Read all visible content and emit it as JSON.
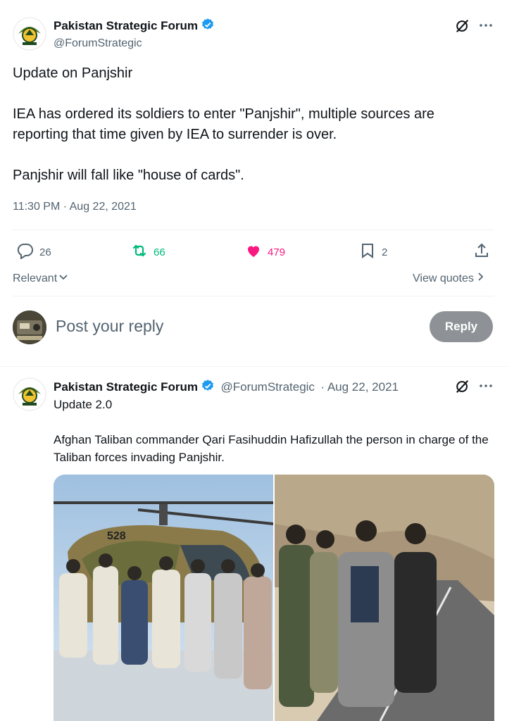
{
  "main_tweet": {
    "author_name": "Pakistan Strategic Forum",
    "author_handle": "@ForumStrategic",
    "text": "Update on Panjshir\n\nIEA has ordered its soldiers to enter \"Panjshir\", multiple sources are reporting that time given by IEA to surrender is over.\n\nPanjshir will fall like \"house of cards\".",
    "timestamp": "11:30 PM · Aug 22, 2021",
    "replies": "26",
    "retweets": "66",
    "likes": "479",
    "bookmarks": "2"
  },
  "sort": {
    "label": "Relevant",
    "view_quotes": "View quotes"
  },
  "composer": {
    "placeholder": "Post your reply",
    "reply_label": "Reply"
  },
  "reply_tweet": {
    "author_name": "Pakistan Strategic Forum",
    "author_handle": "@ForumStrategic",
    "date": "· Aug 22, 2021",
    "title": "Update 2.0",
    "text": "Afghan Taliban commander Qari Fasihuddin Hafizullah the person in charge of the Taliban forces invading Panjshir."
  },
  "colors": {
    "verified": "#1d9bf0",
    "retweet": "#00ba7c",
    "like": "#f91880",
    "secondary_text": "#536471"
  },
  "icons": [
    "grok-icon",
    "more-icon",
    "verified-icon",
    "reply-icon",
    "retweet-icon",
    "like-icon",
    "bookmark-icon",
    "share-icon",
    "chevron-down-icon",
    "chevron-right-icon"
  ]
}
